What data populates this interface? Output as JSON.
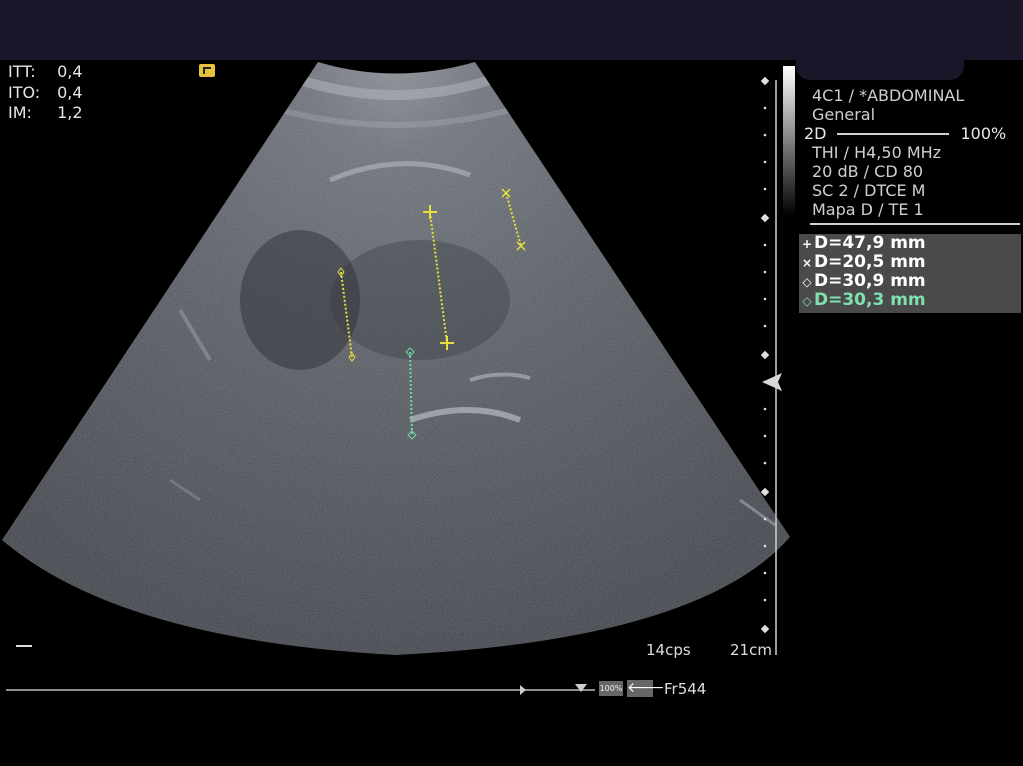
{
  "safety": [
    {
      "key": "ITT:",
      "value": "0,4"
    },
    {
      "key": "ITO:",
      "value": "0,4"
    },
    {
      "key": "IM:",
      "value": "1,2"
    }
  ],
  "probe": {
    "line1": "4C1 / *ABDOMINAL",
    "line2": "General",
    "mode": "2D",
    "mode_percent": "100%",
    "line3": "THI / H4,50 MHz",
    "line4": "20 dB / CD 80",
    "line5": "SC 2 / DTCE M",
    "line6": "Mapa D / TE 1"
  },
  "measurements": [
    {
      "symbol": "+",
      "text": "D=47,9 mm",
      "color": "#ffffff"
    },
    {
      "symbol": "×",
      "text": "D=20,5 mm",
      "color": "#ffffff"
    },
    {
      "symbol": "◇",
      "text": "D=30,9 mm",
      "color": "#ffffff"
    },
    {
      "symbol": "◇",
      "text": "D=30,3 mm",
      "color": "#7fe0b0"
    }
  ],
  "status": {
    "frame_rate": "14cps",
    "depth": "21cm",
    "zoom": "100%",
    "frame": "Fr544"
  },
  "colors": {
    "caliper_yellow": "#e6e03a",
    "caliper_green": "#6fd6a0",
    "header": "#191629"
  }
}
